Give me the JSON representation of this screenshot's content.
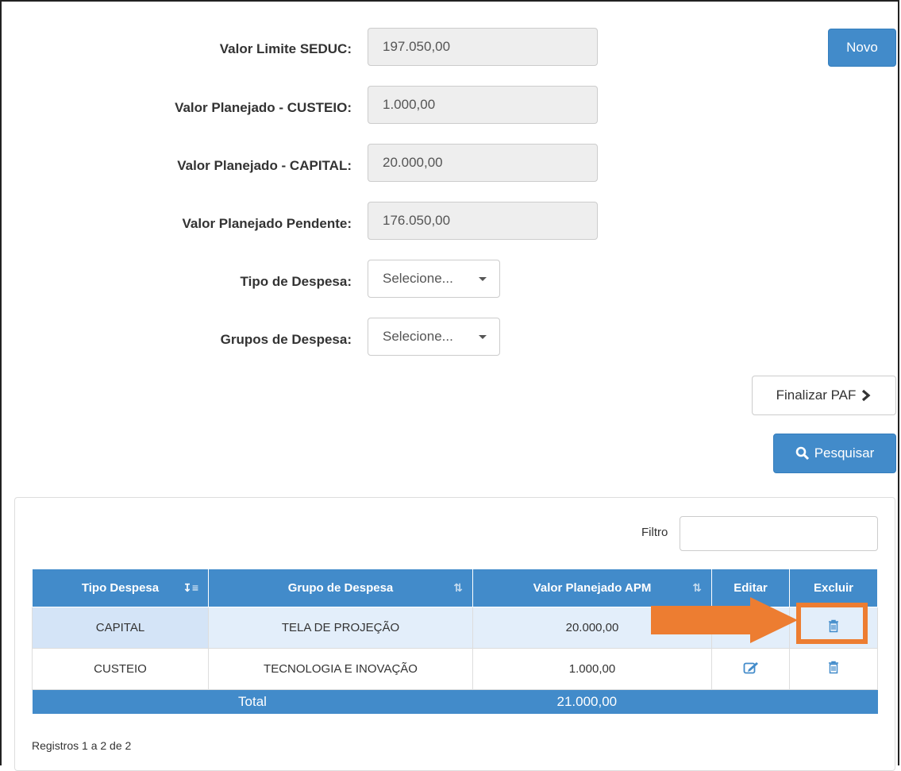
{
  "form": {
    "limite_label": "Valor Limite SEDUC:",
    "limite_value": "197.050,00",
    "custeio_label": "Valor Planejado - CUSTEIO:",
    "custeio_value": "1.000,00",
    "capital_label": "Valor Planejado - CAPITAL:",
    "capital_value": "20.000,00",
    "pendente_label": "Valor Planejado Pendente:",
    "pendente_value": "176.050,00",
    "tipo_label": "Tipo de Despesa:",
    "tipo_value": "Selecione...",
    "grupos_label": "Grupos de Despesa:",
    "grupos_value": "Selecione..."
  },
  "buttons": {
    "novo": "Novo",
    "finalizar": "Finalizar PAF",
    "pesquisar": "Pesquisar"
  },
  "filter": {
    "label": "Filtro"
  },
  "table": {
    "headers": [
      "Tipo Despesa",
      "Grupo de Despesa",
      "Valor Planejado APM",
      "Editar",
      "Excluir"
    ],
    "rows": [
      {
        "tipo": "CAPITAL",
        "grupo": "TELA DE PROJEÇÃO",
        "valor": "20.000,00"
      },
      {
        "tipo": "CUSTEIO",
        "grupo": "TECNOLOGIA E INOVAÇÃO",
        "valor": "1.000,00"
      }
    ],
    "total_label": "Total",
    "total_value": "21.000,00"
  },
  "footer": {
    "registros": "Registros 1 a 2 de 2"
  },
  "icons": {
    "sort_active": "sort-alpha-icon",
    "sort": "sort-icon",
    "edit": "edit-icon",
    "delete": "trash-icon",
    "search": "search-icon",
    "chevron": "chevron-right-icon"
  },
  "colors": {
    "primary": "#428bca",
    "annotation": "#ed7d31"
  }
}
